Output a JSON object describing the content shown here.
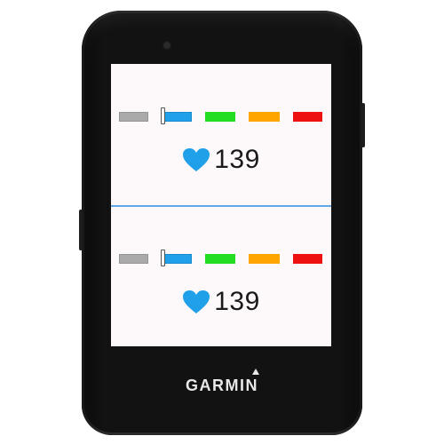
{
  "brand": {
    "name": "GARMIN"
  },
  "zone_colors": [
    "#aaaaaa",
    "#1fa0e8",
    "#22dd22",
    "#ffa500",
    "#ee1111"
  ],
  "fields": [
    {
      "heart_rate": "139",
      "icon": "heart-icon",
      "zone_fill_fraction": 0.15
    },
    {
      "heart_rate": "139",
      "icon": "heart-icon",
      "zone_fill_fraction": 0.15
    }
  ]
}
